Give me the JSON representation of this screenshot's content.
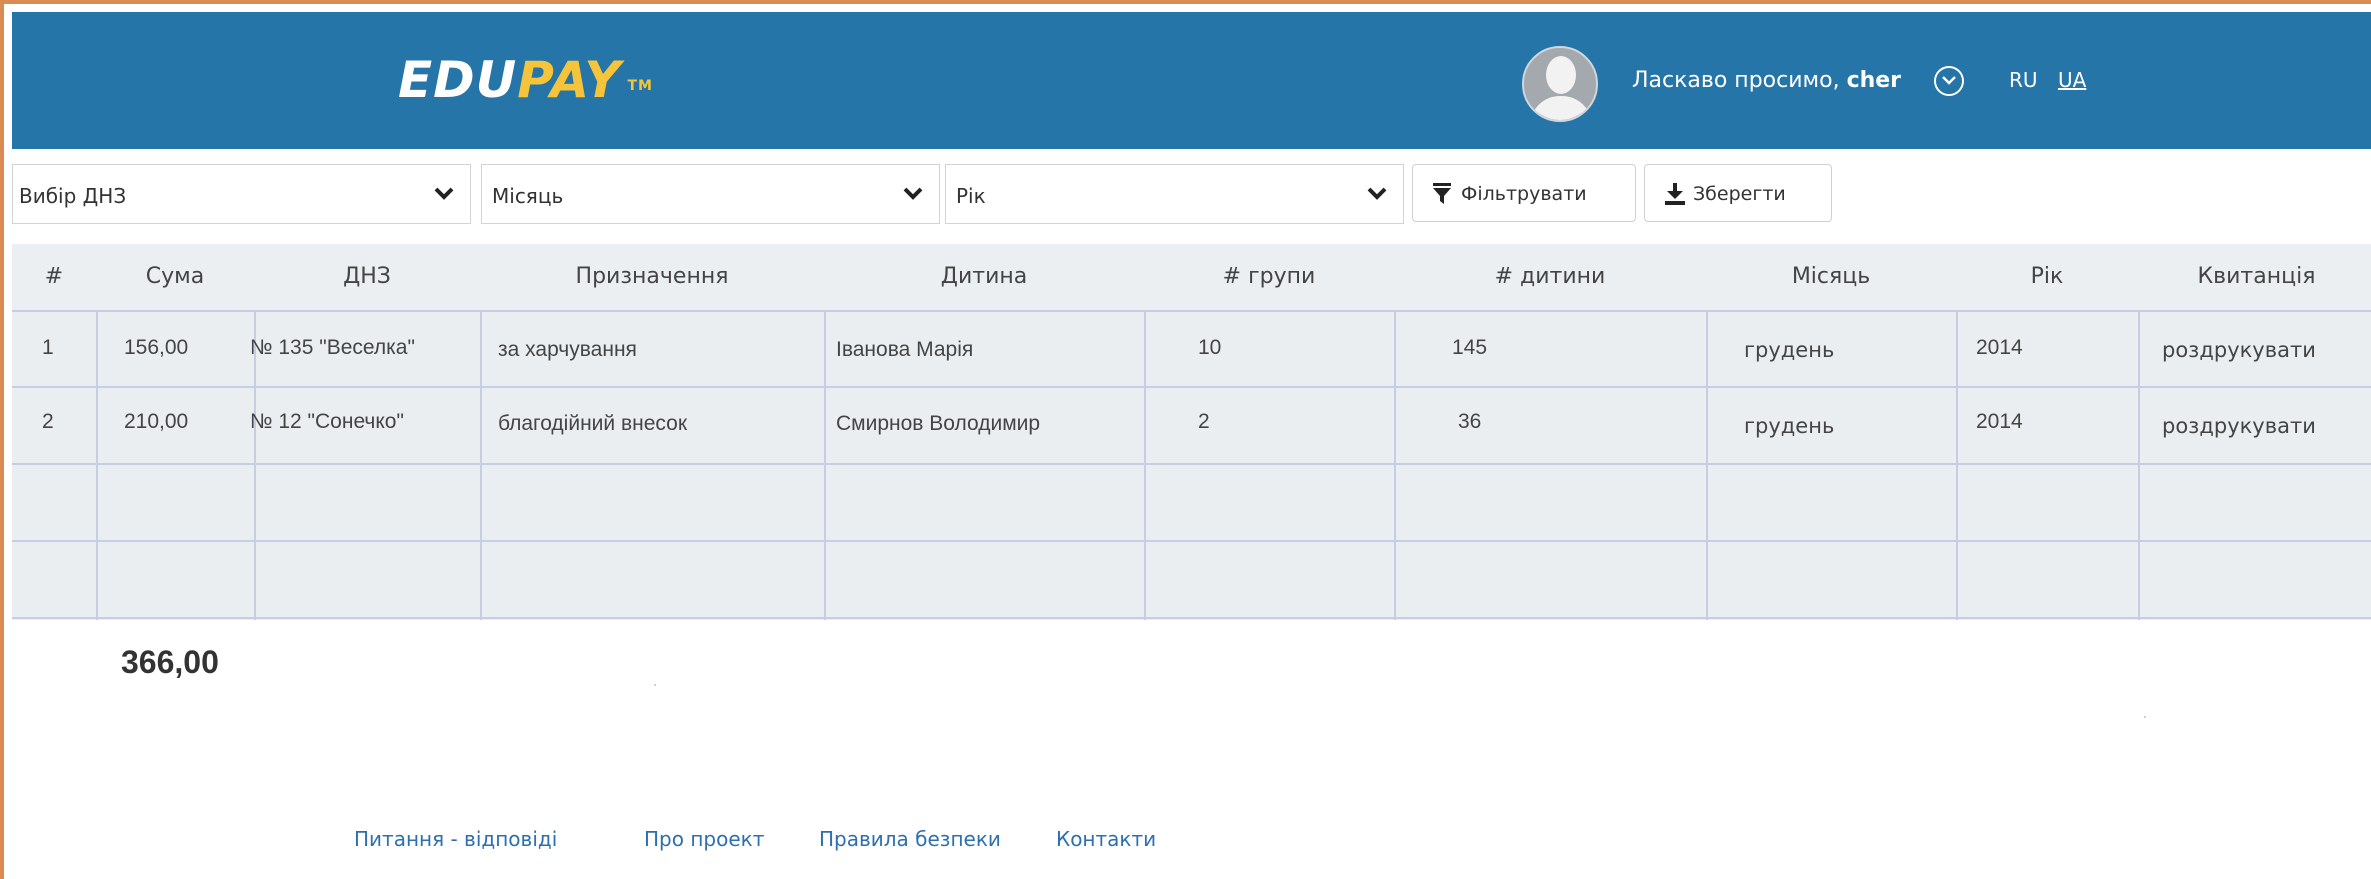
{
  "header": {
    "logo_edu": "EDU",
    "logo_pay": "PAY",
    "logo_tm": "TM",
    "welcome_text": "Ласкаво просимо,",
    "username": "cher",
    "lang_ru": "RU",
    "lang_ua": "UA"
  },
  "filters": {
    "dnz_select": "Вибір ДНЗ",
    "month_select": "Місяць",
    "year_select": "Рік",
    "filter_button": "Фільтрувати",
    "save_button": "Зберегти"
  },
  "table": {
    "columns": [
      "#",
      "Сума",
      "ДНЗ",
      "Призначення",
      "Дитина",
      "# групи",
      "# дитини",
      "Місяць",
      "Рік",
      "Квитанція"
    ],
    "rows": [
      [
        "1",
        "156,00",
        "№ 135 \"Веселка\"",
        "за харчування",
        "Іванова Марія",
        "10",
        "145",
        "грудень",
        "2014",
        "роздрукувати"
      ],
      [
        "2",
        "210,00",
        "№ 12 \"Сонечко\"",
        "благодійний внесок",
        "Смирнов Володимир",
        "2",
        "36",
        "грудень",
        "2014",
        "роздрукувати"
      ]
    ]
  },
  "total": "366,00",
  "footer": {
    "links": [
      "Питання - відповіді",
      "Про проект",
      "Правила безпеки",
      "Контакти"
    ]
  },
  "colors": {
    "header_bg": "#2575a8",
    "logo_accent": "#f6c43a",
    "link": "#2d6fb0",
    "frame": "#d98b52"
  }
}
